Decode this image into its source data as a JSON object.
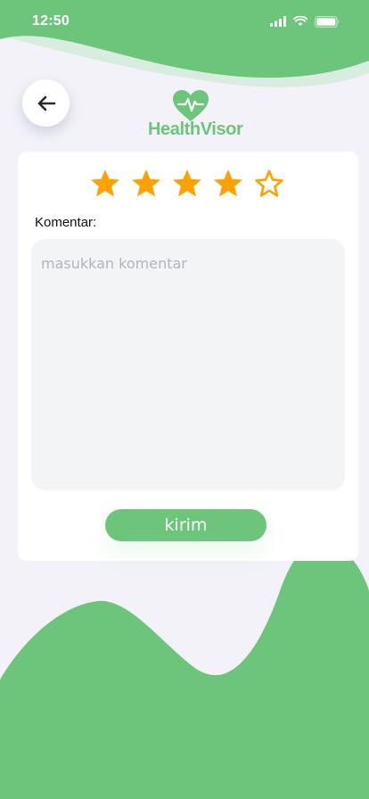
{
  "status_bar": {
    "time": "12:50"
  },
  "logo": {
    "text": "HealthVisor"
  },
  "rating": {
    "value": 4,
    "max": 5
  },
  "comment": {
    "label": "Komentar:",
    "value": "",
    "placeholder": "masukkan komentar"
  },
  "submit": {
    "label": "kirim"
  },
  "colors": {
    "brand_green": "#6cc57a",
    "light_wave": "#d8ede0",
    "star_orange": "#ffa201",
    "background": "#f2f2f8",
    "input_background": "#f3f4f6"
  }
}
